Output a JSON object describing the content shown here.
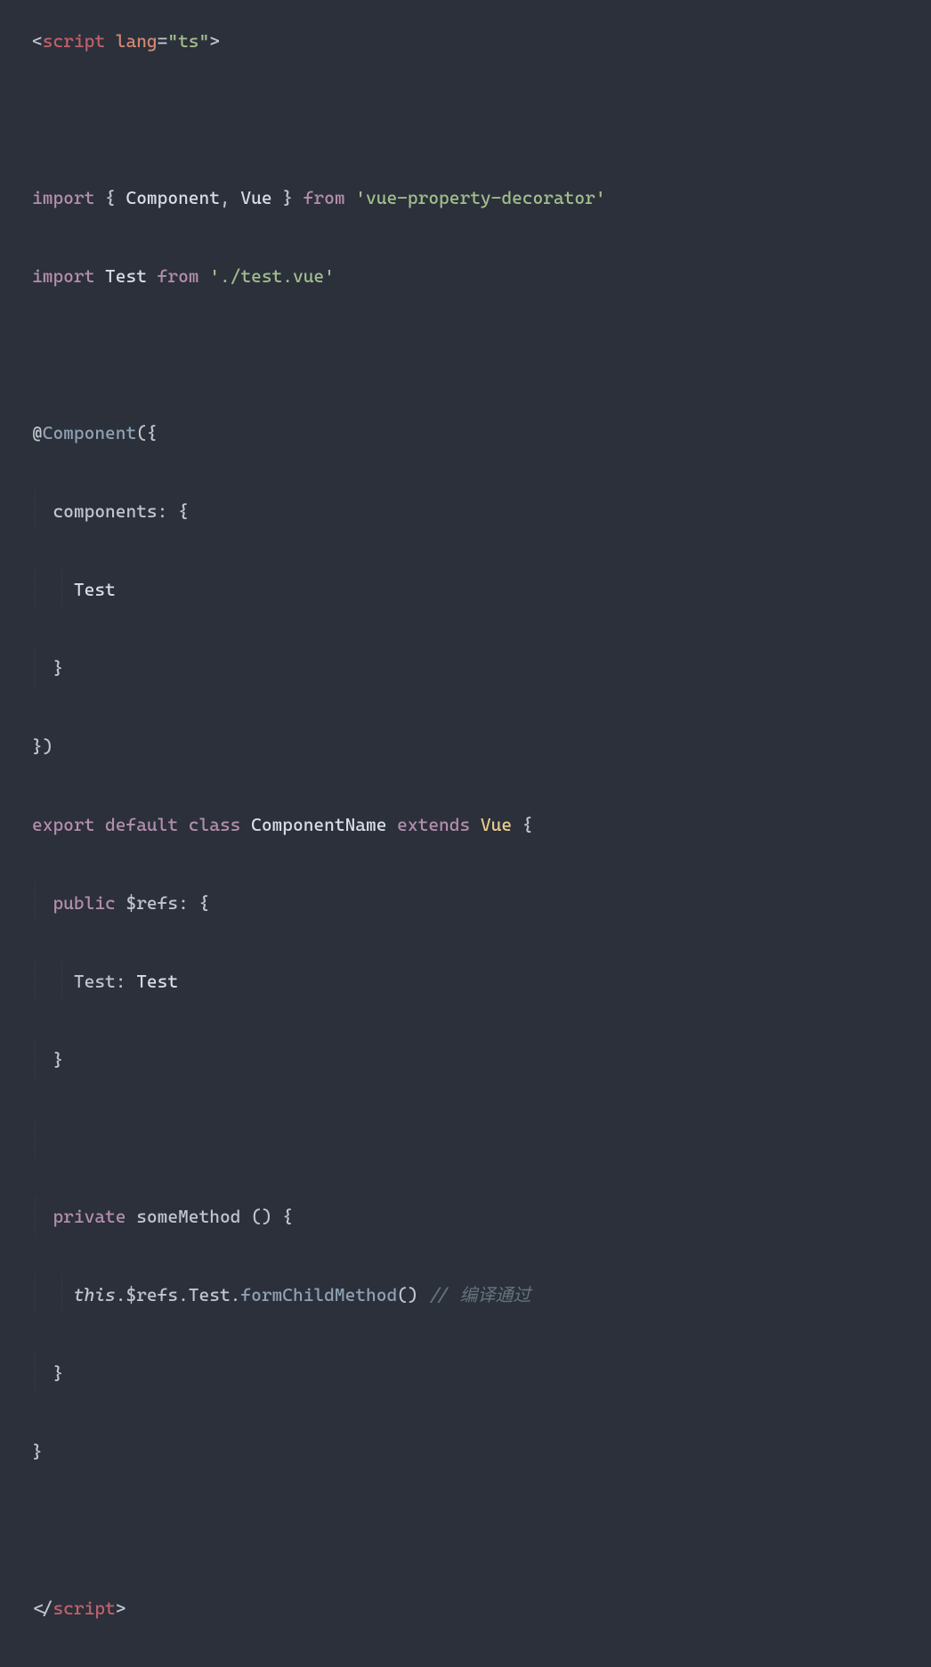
{
  "lines": {
    "l1": {
      "open": "<",
      "tag": "script",
      "sp": " ",
      "attr": "lang",
      "eq": "=",
      "q1": "\"",
      "val": "ts",
      "q2": "\"",
      "close": ">"
    },
    "l2": {
      "kw1": "import",
      "sp1": " ",
      "b1": "{",
      "sp2": " ",
      "i1": "Component",
      "c1": ",",
      "sp3": " ",
      "i2": "Vue",
      "sp4": " ",
      "b2": "}",
      "sp5": " ",
      "kw2": "from",
      "sp6": " ",
      "q1": "'",
      "s1": "vue-property-decorator",
      "q2": "'"
    },
    "l3": {
      "kw1": "import",
      "sp1": " ",
      "i1": "Test",
      "sp2": " ",
      "kw2": "from",
      "sp3": " ",
      "q1": "'",
      "s1": "./test.vue",
      "q2": "'"
    },
    "l4": {
      "at": "@",
      "deco": "Component",
      "p1": "(",
      "b1": "{"
    },
    "l5": {
      "indent": "  ",
      "lbl": "components",
      "col": ":",
      "sp": " ",
      "b": "{"
    },
    "l6": {
      "indent": "    ",
      "i": "Test"
    },
    "l7": {
      "indent": "  ",
      "b": "}"
    },
    "l8": {
      "b": "}",
      "p": ")"
    },
    "l9": {
      "kw1": "export",
      "sp1": " ",
      "kw2": "default",
      "sp2": " ",
      "kw3": "class",
      "sp3": " ",
      "cn": "ComponentName",
      "sp4": " ",
      "kw4": "extends",
      "sp5": " ",
      "sc": "Vue",
      "sp6": " ",
      "b": "{"
    },
    "l10": {
      "indent": "  ",
      "kw": "public",
      "sp1": " ",
      "nm": "$refs",
      "col": ":",
      "sp2": " ",
      "b": "{"
    },
    "l11": {
      "indent": "    ",
      "nm": "Test",
      "col": ":",
      "sp": " ",
      "ty": "Test"
    },
    "l12": {
      "indent": "  ",
      "b": "}"
    },
    "l13": {
      "indent": "  ",
      "kw": "private",
      "sp1": " ",
      "nm": "someMethod",
      "sp2": " ",
      "p1": "(",
      "p2": ")",
      "sp3": " ",
      "b": "{"
    },
    "l14": {
      "indent": "    ",
      "th": "this",
      "d1": ".",
      "p1": "$refs",
      "d2": ".",
      "p2": "Test",
      "d3": ".",
      "fn": "formChildMethod",
      "pa": "(",
      "pb": ")",
      "sp": " ",
      "cs": "//",
      "csp": " ",
      "ct": "编译通过"
    },
    "l15": {
      "indent": "  ",
      "b": "}"
    },
    "l16": {
      "b": "}"
    },
    "l17": {
      "open": "<",
      "sl": "/",
      "tag": "script",
      "close": ">"
    }
  }
}
